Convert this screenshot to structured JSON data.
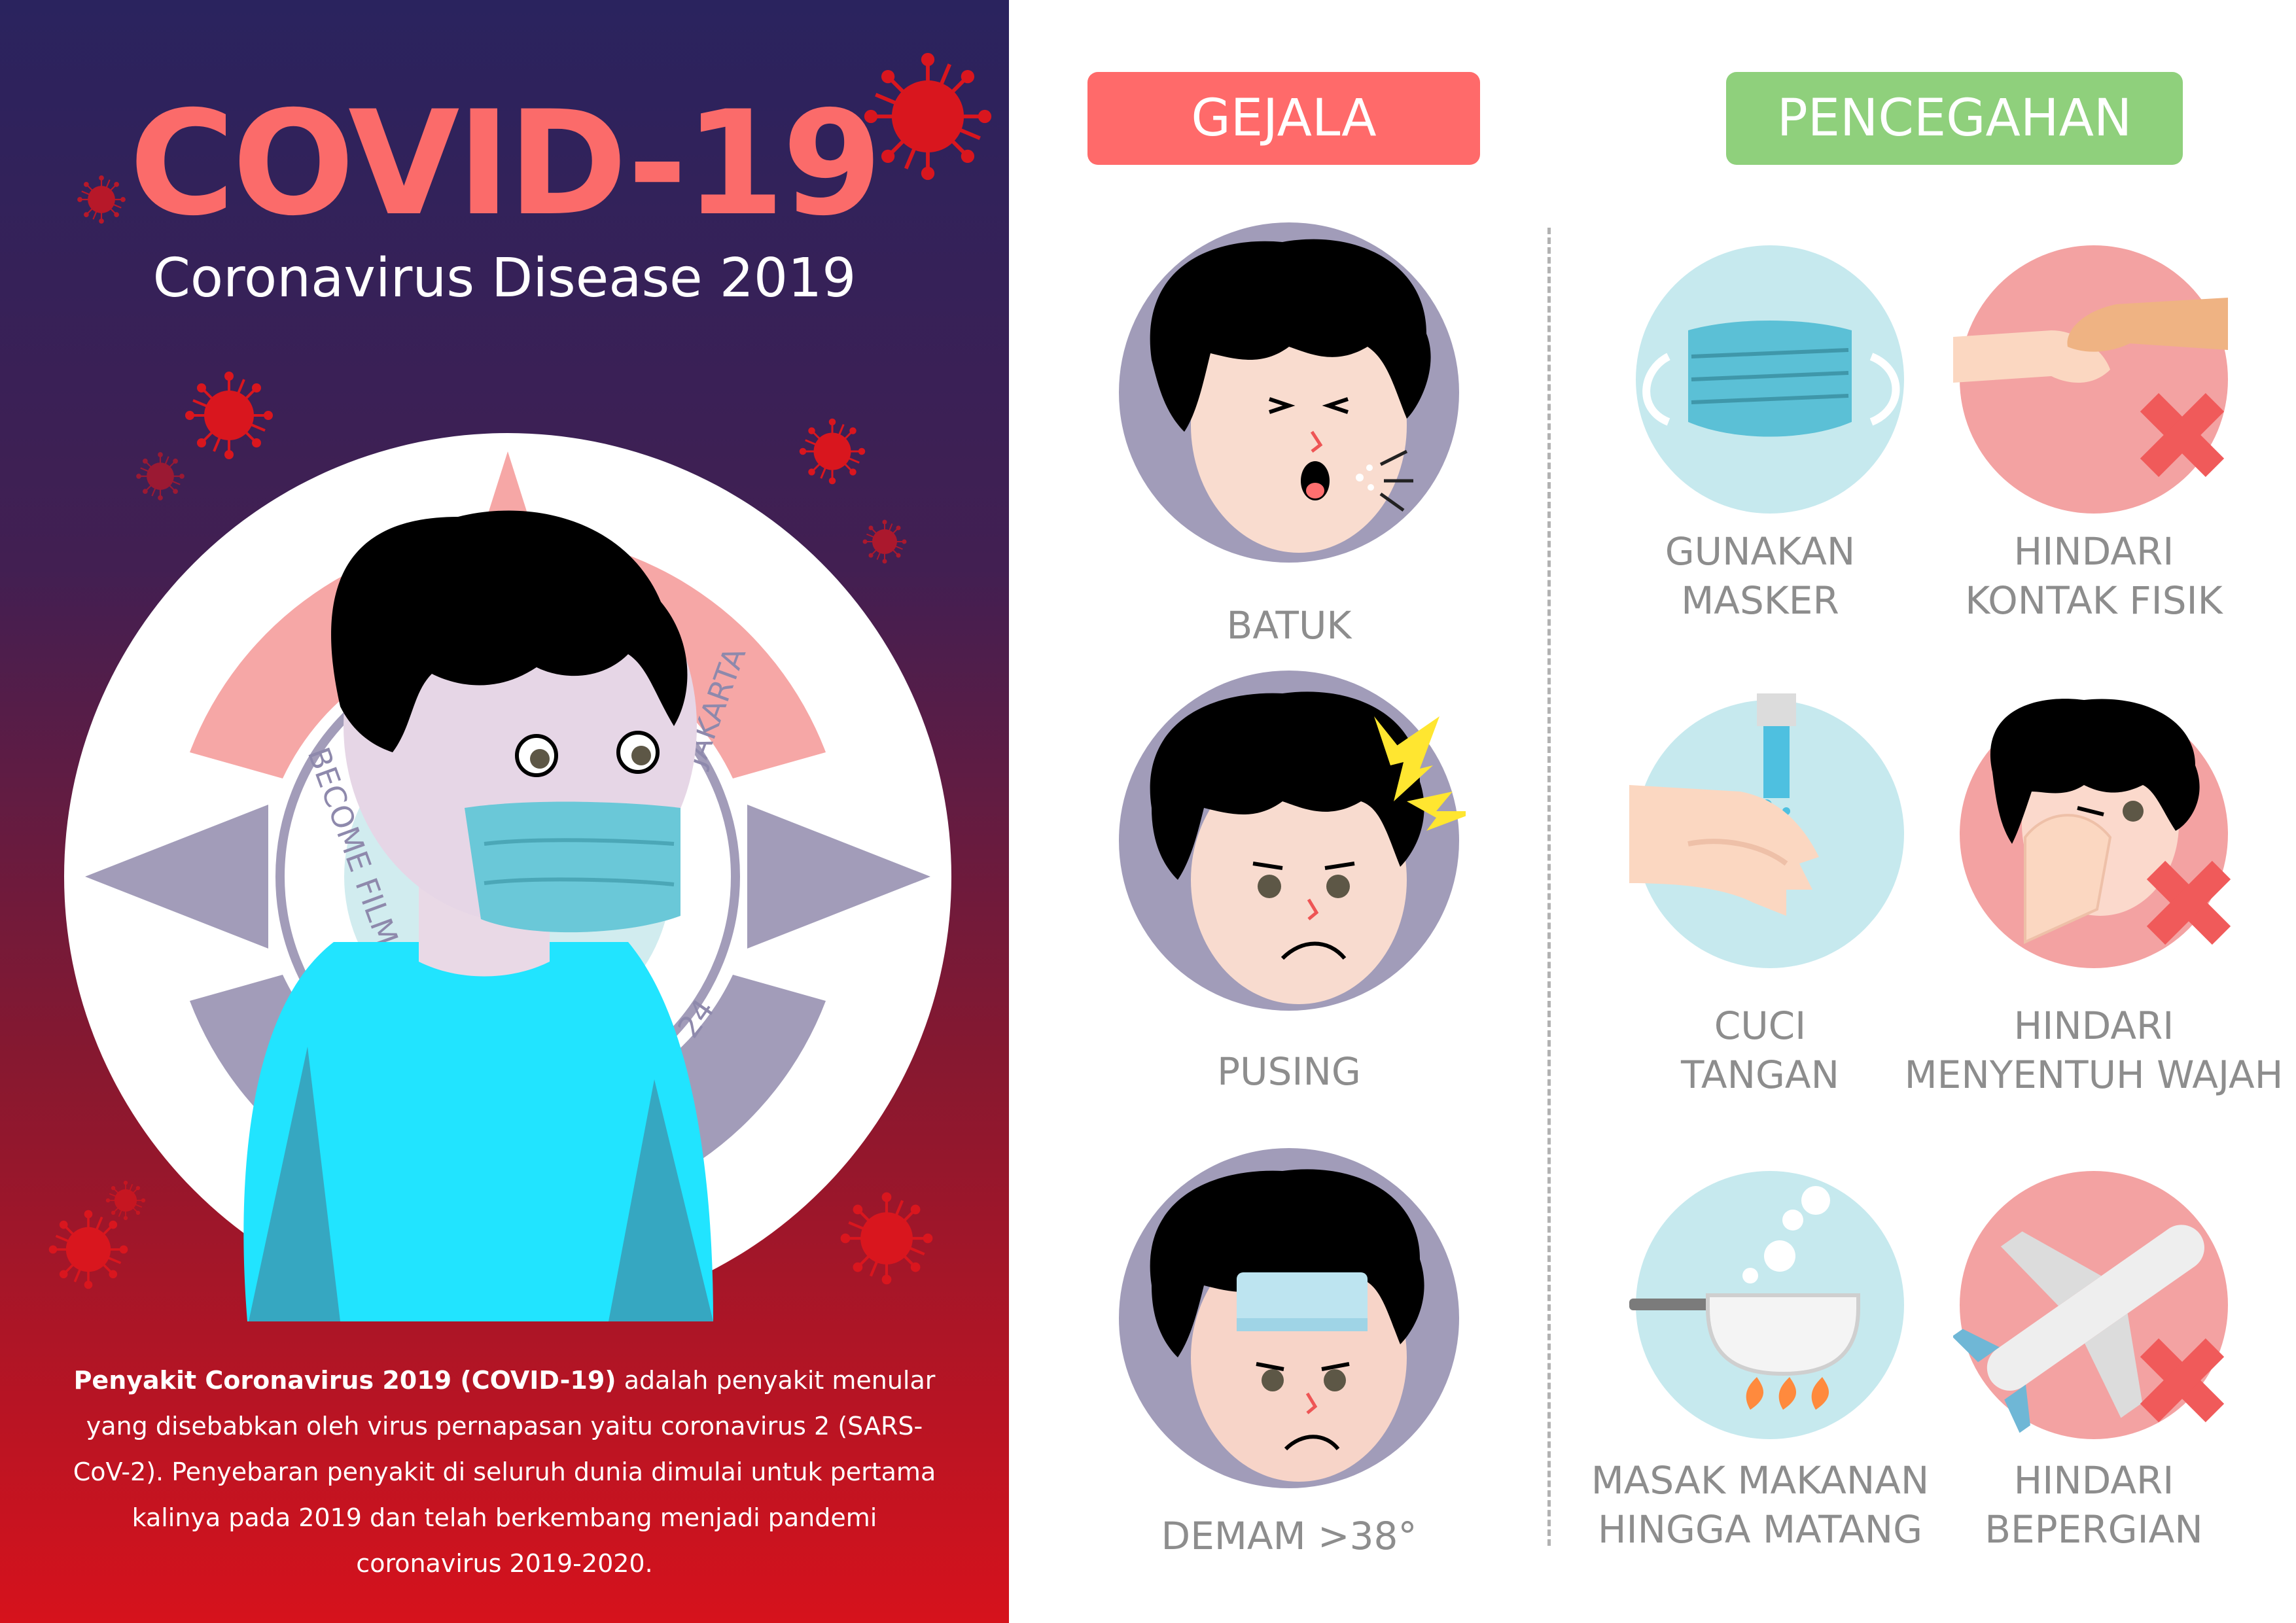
{
  "poster": {
    "title": "COVID-19",
    "subtitle": "Coronavirus Disease 2019",
    "description_bold": "Penyakit Coronavirus 2019 (COVID-19)",
    "description_rest": " adalah penyakit menular yang disebabkan oleh virus pernapasan yaitu coronavirus 2 (SARS-CoV-2). Penyebaran penyakit di seluruh dunia dimulai untuk pertama kalinya pada 2019 dan telah berkembang menjadi pandemi coronavirus 2019-2020."
  },
  "badge_text": {
    "left": "BECOME FILMS",
    "right": "JAKARTA",
    "number": "24"
  },
  "sections": {
    "symptoms_label": "GEJALA",
    "prevention_label": "PENCEGAHAN"
  },
  "symptoms": [
    {
      "label": "BATUK"
    },
    {
      "label": "PUSING"
    },
    {
      "label": "DEMAM >38°"
    }
  ],
  "prevention": [
    {
      "line1": "GUNAKAN",
      "line2": "MASKER",
      "crossed": false
    },
    {
      "line1": "HINDARI",
      "line2": "KONTAK FISIK",
      "crossed": true
    },
    {
      "line1": "CUCI",
      "line2": "TANGAN",
      "crossed": false
    },
    {
      "line1": "HINDARI",
      "line2": "MENYENTUH WAJAH",
      "crossed": true
    },
    {
      "line1": "MASAK MAKANAN",
      "line2": "HINGGA MATANG",
      "crossed": false
    },
    {
      "line1": "HINDARI",
      "line2": "BEPERGIAN",
      "crossed": true
    }
  ],
  "colors": {
    "title": "#fb6b6a",
    "gejala_pill": "#ff6a6a",
    "pencegahan_pill": "#8fd07c",
    "label_gray": "#8d8d8d",
    "symptom_circle": "#a19cb9",
    "prevent_circle": "#c6e9ee",
    "avoid_circle": "#f3a2a2",
    "cross": "#f05a5a",
    "virus": "#d9161e"
  }
}
